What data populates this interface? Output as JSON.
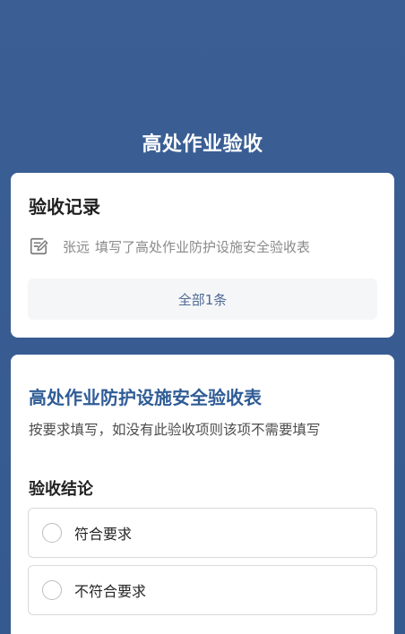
{
  "header": {
    "title": "高处作业验收"
  },
  "records": {
    "heading": "验收记录",
    "items": [
      {
        "author": "张远",
        "text": "填写了高处作业防护设施安全验收表",
        "icon": "edit-form-icon"
      }
    ],
    "all_label": "全部1条"
  },
  "form": {
    "title": "高处作业防护设施安全验收表",
    "description": "按要求填写，如没有此验收项则该项不需要填写",
    "conclusion_label": "验收结论",
    "options": [
      {
        "label": "符合要求",
        "selected": false
      },
      {
        "label": "不符合要求",
        "selected": false
      }
    ]
  },
  "colors": {
    "background": "#375c93",
    "accent_title": "#2f5c96",
    "link_text": "#4f6a93"
  }
}
